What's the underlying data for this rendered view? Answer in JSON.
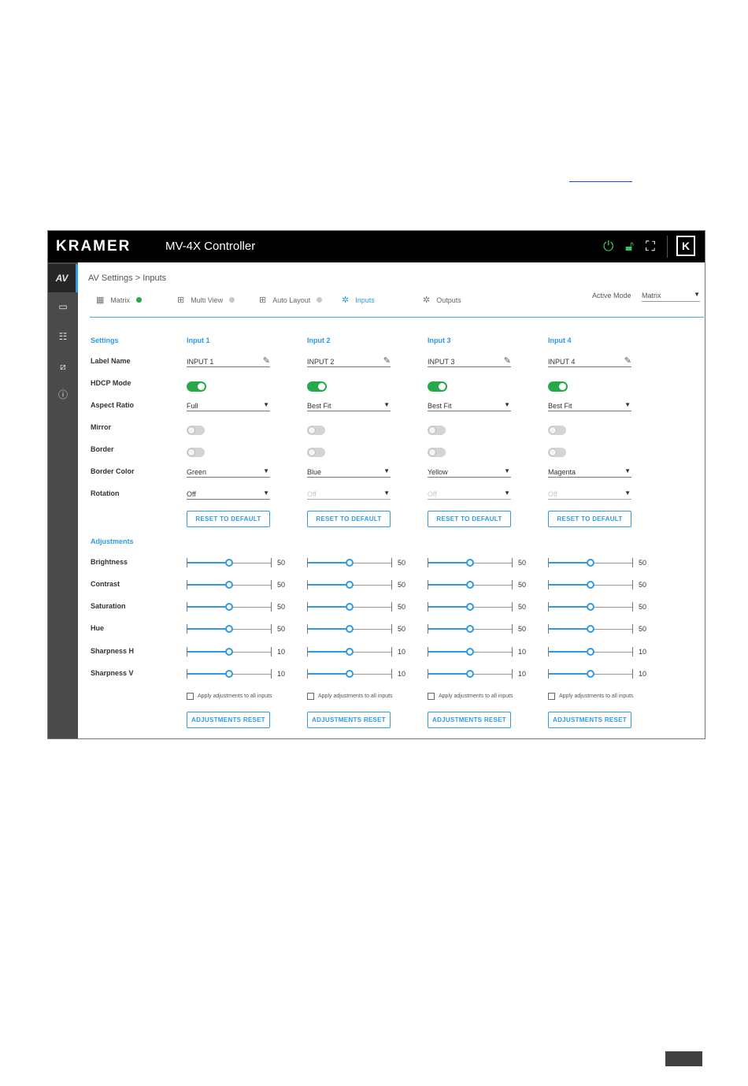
{
  "app": {
    "logo": "KRAMER",
    "title": "MV-4X Controller",
    "klogo": "K",
    "sidebar": [
      {
        "label": "AV",
        "icon": "av-icon"
      },
      {
        "label": "▭",
        "icon": "display-icon"
      },
      {
        "label": "☷",
        "icon": "settings-list-icon"
      },
      {
        "label": "⧄",
        "icon": "screen-icon"
      },
      {
        "label": "ⓘ",
        "icon": "info-icon"
      }
    ]
  },
  "breadcrumb": "AV Settings > Inputs",
  "tabs": [
    {
      "label": "Matrix",
      "icon": "▦",
      "status": "green"
    },
    {
      "label": "Multi View",
      "icon": "⊞",
      "status": "gray"
    },
    {
      "label": "Auto Layout",
      "icon": "⊞",
      "status": "gray"
    },
    {
      "label": "Inputs",
      "icon": "✲",
      "status": "active"
    },
    {
      "label": "Outputs",
      "icon": "✲",
      "status": "none"
    }
  ],
  "active_mode": {
    "label": "Active Mode",
    "value": "Matrix"
  },
  "colors": {
    "accent": "#2f9ae3",
    "toggle_on": "#27a94b",
    "dot_green": "#27a94b",
    "dot_gray": "#c8c8c8"
  },
  "settings": {
    "title": "Settings",
    "rows": [
      "Label Name",
      "HDCP Mode",
      "Aspect Ratio",
      "Mirror",
      "Border",
      "Border Color",
      "Rotation"
    ]
  },
  "adjustments": {
    "title": "Adjustments",
    "rows": [
      "Brightness",
      "Contrast",
      "Saturation",
      "Hue",
      "Sharpness H",
      "Sharpness V"
    ],
    "apply_label": "Apply adjustments to all inputs",
    "reset_label": "ADJUSTMENTS RESET"
  },
  "reset_default_label": "RESET TO DEFAULT",
  "inputs": [
    {
      "title": "Input 1",
      "label_name": "INPUT 1",
      "hdcp": true,
      "aspect_ratio": "Full",
      "mirror": false,
      "border": false,
      "border_color": "Green",
      "rotation": "Off",
      "rotation_disabled": false,
      "adjust": [
        50,
        50,
        50,
        50,
        10,
        10
      ]
    },
    {
      "title": "Input 2",
      "label_name": "INPUT 2",
      "hdcp": true,
      "aspect_ratio": "Best Fit",
      "mirror": false,
      "border": false,
      "border_color": "Blue",
      "rotation": "Off",
      "rotation_disabled": true,
      "adjust": [
        50,
        50,
        50,
        50,
        10,
        10
      ]
    },
    {
      "title": "Input 3",
      "label_name": "INPUT 3",
      "hdcp": true,
      "aspect_ratio": "Best Fit",
      "mirror": false,
      "border": false,
      "border_color": "Yellow",
      "rotation": "Off",
      "rotation_disabled": true,
      "adjust": [
        50,
        50,
        50,
        50,
        10,
        10
      ]
    },
    {
      "title": "Input 4",
      "label_name": "INPUT 4",
      "hdcp": true,
      "aspect_ratio": "Best Fit",
      "mirror": false,
      "border": false,
      "border_color": "Magenta",
      "rotation": "Off",
      "rotation_disabled": true,
      "adjust": [
        50,
        50,
        50,
        50,
        10,
        10
      ]
    }
  ],
  "slider_fraction": 0.5
}
